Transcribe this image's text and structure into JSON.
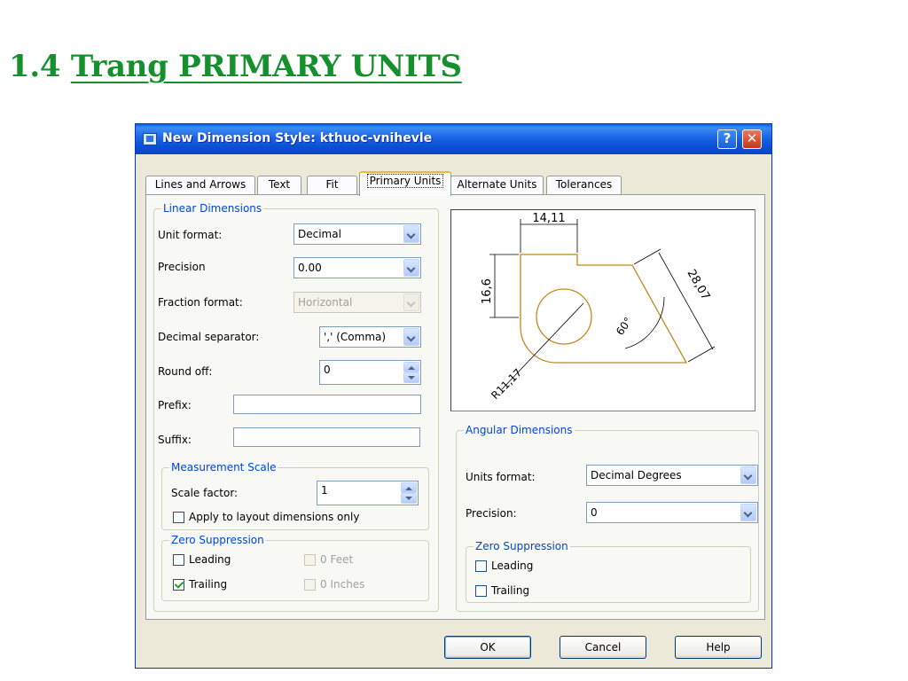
{
  "slide": {
    "title_number": "1.4",
    "title_text": "Trang PRIMARY UNITS"
  },
  "dialog": {
    "title": "New Dimension Style: kthuoc-vnihevle",
    "help_glyph": "?",
    "close_glyph": "✕",
    "tabs": [
      {
        "label": "Lines and Arrows"
      },
      {
        "label": "Text"
      },
      {
        "label": "Fit"
      },
      {
        "label": "Primary Units",
        "active": true
      },
      {
        "label": "Alternate Units"
      },
      {
        "label": "Tolerances"
      }
    ],
    "linear": {
      "legend": "Linear Dimensions",
      "unit_format_label": "Unit format:",
      "unit_format_value": "Decimal",
      "precision_label": "Precision",
      "precision_value": "0.00",
      "fraction_format_label": "Fraction format:",
      "fraction_format_value": "Horizontal",
      "decimal_separator_label": "Decimal separator:",
      "decimal_separator_value": "',' (Comma)",
      "round_off_label": "Round off:",
      "round_off_value": "0",
      "prefix_label": "Prefix:",
      "prefix_value": "",
      "suffix_label": "Suffix:",
      "suffix_value": "",
      "measurement": {
        "legend": "Measurement Scale",
        "scale_factor_label": "Scale factor:",
        "scale_factor_value": "1",
        "apply_layout_label": "Apply to layout dimensions only",
        "apply_layout_checked": false
      },
      "zero_suppression": {
        "legend": "Zero Suppression",
        "leading_label": "Leading",
        "trailing_label": "Trailing",
        "feet_label": "0 Feet",
        "inches_label": "0 Inches",
        "leading_checked": false,
        "trailing_checked": true
      }
    },
    "preview": {
      "dim_top": "14,11",
      "dim_left": "16,6",
      "dim_right": "28,07",
      "dim_angle": "60°",
      "dim_radius": "R11,17"
    },
    "angular": {
      "legend": "Angular Dimensions",
      "units_format_label": "Units format:",
      "units_format_value": "Decimal Degrees",
      "precision_label": "Precision:",
      "precision_value": "0",
      "zero_suppression": {
        "legend": "Zero Suppression",
        "leading_label": "Leading",
        "trailing_label": "Trailing",
        "leading_checked": false,
        "trailing_checked": false
      }
    },
    "buttons": {
      "ok": "OK",
      "cancel": "Cancel",
      "help": "Help"
    },
    "colors": {
      "title_green": "#16902d",
      "group_legend": "#0046d5",
      "preview_outline": "#c08a1e"
    }
  }
}
